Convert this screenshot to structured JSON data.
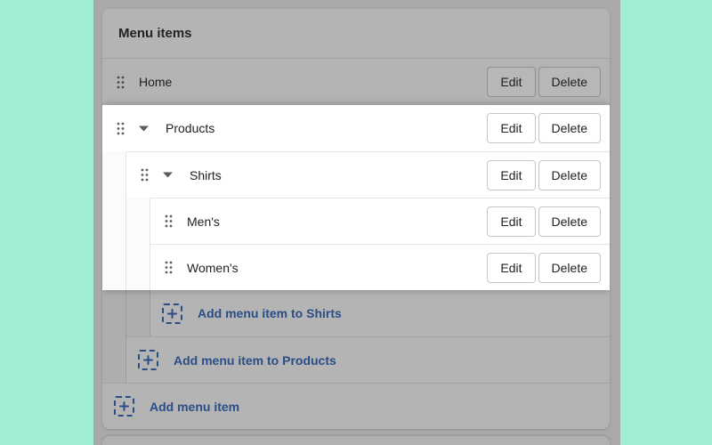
{
  "card": {
    "title": "Menu items"
  },
  "labels": {
    "edit": "Edit",
    "delete": "Delete"
  },
  "menu": {
    "items": [
      {
        "label": "Home",
        "level": 0,
        "expandable": false,
        "dimmed": true
      },
      {
        "label": "Products",
        "level": 0,
        "expandable": true,
        "dimmed": false
      },
      {
        "label": "Shirts",
        "level": 1,
        "expandable": true,
        "dimmed": false
      },
      {
        "label": "Men's",
        "level": 2,
        "expandable": false,
        "dimmed": false
      },
      {
        "label": "Women's",
        "level": 2,
        "expandable": false,
        "dimmed": false
      }
    ],
    "add_actions": [
      {
        "label": "Add menu item to Shirts",
        "level": 2
      },
      {
        "label": "Add menu item to Products",
        "level": 1
      },
      {
        "label": "Add menu item",
        "level": 0
      }
    ]
  },
  "colors": {
    "background_mint": "#a2edd5",
    "dim_overlay": "#a9a9aa",
    "highlight_row": "#ffffff",
    "link_blue_dimmed": "#2b4d86",
    "accent_blue": "#2c6ecb"
  }
}
